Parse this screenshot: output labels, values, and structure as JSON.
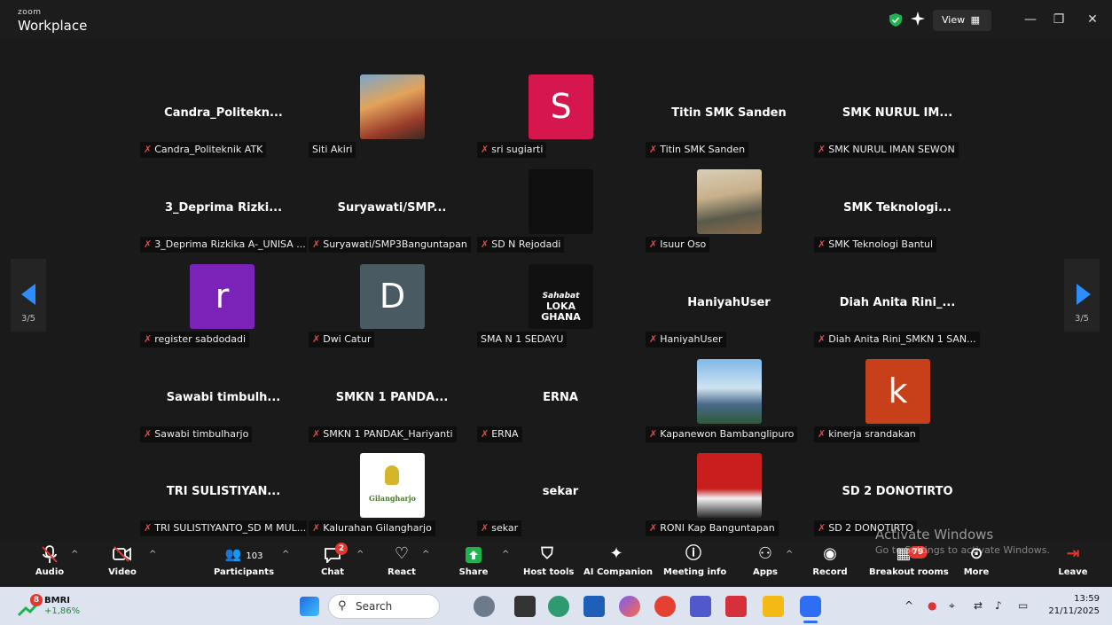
{
  "window": {
    "brand_small": "zoom",
    "brand_big": "Workplace",
    "view_label": "View"
  },
  "gallery": {
    "page_left": "3/5",
    "page_right": "3/5",
    "tiles": [
      {
        "name": "Candra_Politekn...",
        "caption": "Candra_Politeknik ATK",
        "muted": true,
        "avatar": null
      },
      {
        "name": "",
        "caption": "Siti Akiri",
        "muted": false,
        "avatar": "photo-couple"
      },
      {
        "name": "",
        "caption": "sri sugiarti",
        "muted": true,
        "avatar": "S",
        "color": "#d6174d"
      },
      {
        "name": "Titin SMK Sanden",
        "caption": "Titin SMK Sanden",
        "muted": true,
        "avatar": null
      },
      {
        "name": "SMK NURUL IM...",
        "caption": "SMK NURUL IMAN SEWON",
        "muted": true,
        "avatar": null
      },
      {
        "name": "3_Deprima Rizki...",
        "caption": "3_Deprima Rizkika A-_UNISA ...",
        "muted": true,
        "avatar": null
      },
      {
        "name": "Suryawati/SMP...",
        "caption": "Suryawati/SMP3Banguntapan",
        "muted": true,
        "avatar": null
      },
      {
        "name": "",
        "caption": "SD N Rejodadi",
        "muted": true,
        "avatar": "dark-video"
      },
      {
        "name": "",
        "caption": "Isuur Oso",
        "muted": true,
        "avatar": "photo-meeting"
      },
      {
        "name": "SMK Teknologi...",
        "caption": "SMK Teknologi Bantul",
        "muted": true,
        "avatar": null
      },
      {
        "name": "",
        "caption": "register sabdodadi",
        "muted": true,
        "avatar": "r",
        "color": "#7b22b8"
      },
      {
        "name": "",
        "caption": "Dwi Catur",
        "muted": true,
        "avatar": "D",
        "color": "#4a5a63"
      },
      {
        "name": "",
        "caption": "SMA N 1 SEDAYU",
        "muted": false,
        "avatar": "logo-text",
        "logo_line1": "Sahabat",
        "logo_line2": "LOKA GHANA"
      },
      {
        "name": "HaniyahUser",
        "caption": "HaniyahUser",
        "muted": true,
        "avatar": null
      },
      {
        "name": "Diah Anita Rini_...",
        "caption": "Diah Anita Rini_SMKN 1 SAN...",
        "muted": true,
        "avatar": null
      },
      {
        "name": "Sawabi timbulh...",
        "caption": "Sawabi timbulharjo",
        "muted": true,
        "avatar": null
      },
      {
        "name": "SMKN 1 PANDA...",
        "caption": "SMKN 1 PANDAK_Hariyanti",
        "muted": true,
        "avatar": null
      },
      {
        "name": "ERNA",
        "caption": "ERNA",
        "muted": true,
        "avatar": null
      },
      {
        "name": "",
        "caption": "Kapanewon Bambanglipuro",
        "muted": true,
        "avatar": "photo-city"
      },
      {
        "name": "",
        "caption": "kinerja srandakan",
        "muted": true,
        "avatar": "k",
        "color": "#c8401a"
      },
      {
        "name": "TRI SULISTIYAN...",
        "caption": "TRI SULISTIYANTO_SD M MUL...",
        "muted": true,
        "avatar": null
      },
      {
        "name": "",
        "caption": "Kalurahan Gilangharjo",
        "muted": true,
        "avatar": "logo-gilangharjo",
        "logo_text": "Gilangharjo"
      },
      {
        "name": "sekar",
        "caption": "sekar",
        "muted": true,
        "avatar": null
      },
      {
        "name": "",
        "caption": "RONI Kap Banguntapan",
        "muted": true,
        "avatar": "photo-portrait"
      },
      {
        "name": "SD 2 DONOTIRTO",
        "caption": "SD 2 DONOTIRTO",
        "muted": true,
        "avatar": null
      }
    ]
  },
  "toolbar": {
    "audio": "Audio",
    "video": "Video",
    "participants": "Participants",
    "participants_count": "103",
    "chat": "Chat",
    "chat_badge": "2",
    "react": "React",
    "share": "Share",
    "host_tools": "Host tools",
    "ai_companion": "AI Companion",
    "meeting_info": "Meeting info",
    "apps": "Apps",
    "record": "Record",
    "breakout_rooms": "Breakout rooms",
    "breakout_badge": "79",
    "more": "More",
    "leave": "Leave"
  },
  "watermark": {
    "line1": "Activate Windows",
    "line2": "Go to Settings to activate Windows."
  },
  "taskbar": {
    "weather_badge": "8",
    "weather_title": "BMRI",
    "weather_value": "+1,86%",
    "search_placeholder": "Search",
    "time": "13:59",
    "date": "21/11/2025"
  }
}
